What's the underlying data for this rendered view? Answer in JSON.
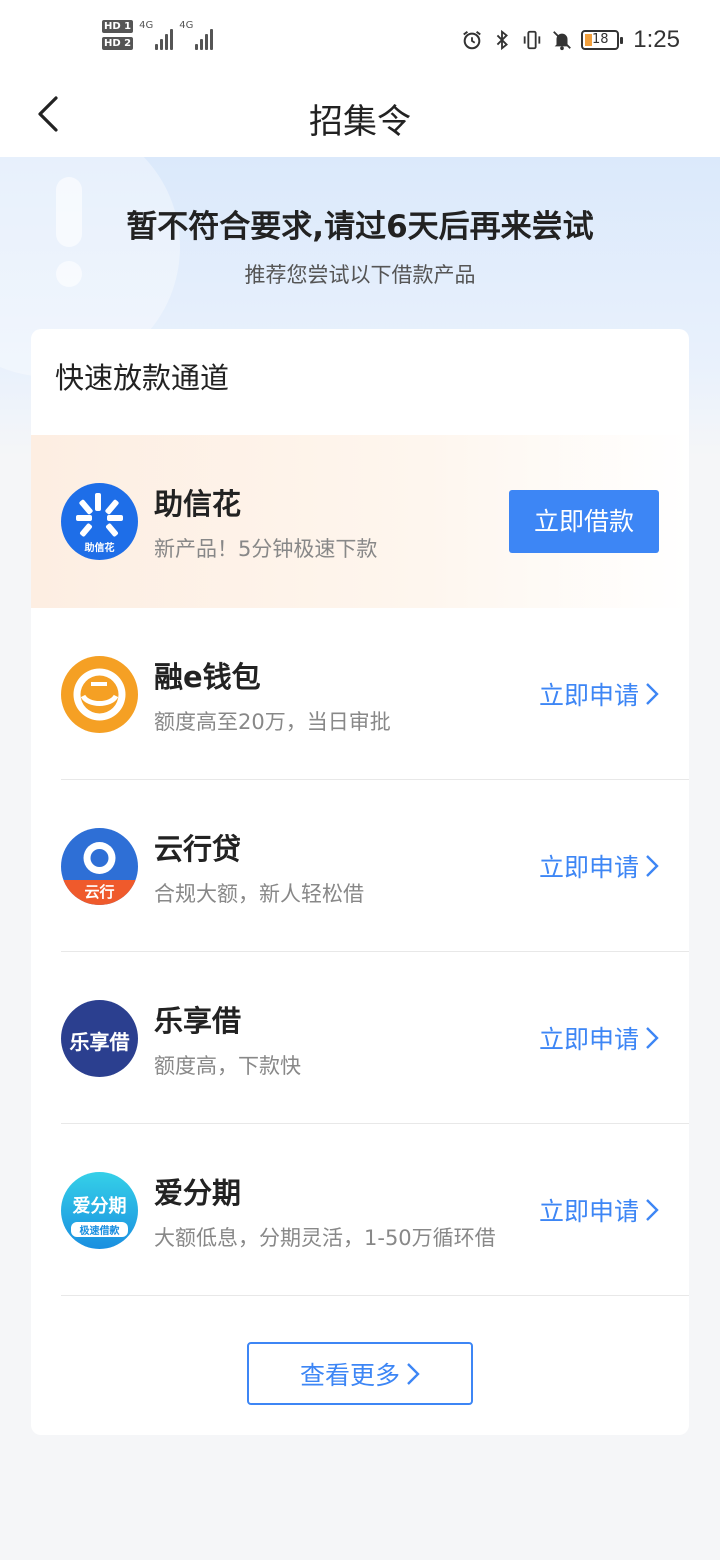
{
  "status_bar": {
    "sim1_label": "HD 1",
    "sim2_label": "HD 2",
    "network1": "4G",
    "network2": "4G",
    "battery_level": "18",
    "time": "1:25",
    "icons": [
      "alarm-icon",
      "bluetooth-icon",
      "vibrate-icon",
      "mute-icon",
      "battery-icon"
    ]
  },
  "nav": {
    "title": "招集令",
    "back_icon": "chevron-left-icon"
  },
  "hero": {
    "title": "暂不符合要求,请过6天后再来尝试",
    "subtitle": "推荐您尝试以下借款产品"
  },
  "section": {
    "title": "快速放款通道",
    "featured": {
      "name": "助信花",
      "desc": "新产品！5分钟极速下款",
      "logo_text": "助信花",
      "button": "立即借款"
    },
    "items": [
      {
        "name": "融e钱包",
        "desc": "额度高至20万，当日审批",
        "action": "立即申请",
        "logo_color": "#f5a024"
      },
      {
        "name": "云行贷",
        "desc": "合规大额，新人轻松借",
        "action": "立即申请",
        "logo_text": "云行",
        "logo_color": "#2e6fd6"
      },
      {
        "name": "乐享借",
        "desc": "额度高，下款快",
        "action": "立即申请",
        "logo_text": "乐享借",
        "logo_color": "#2b3f8f"
      },
      {
        "name": "爱分期",
        "desc": "大额低息，分期灵活，1-50万循环借",
        "action": "立即申请",
        "logo_text": "爱分期",
        "logo_sub": "极速借款",
        "logo_color": "#2bb7e0"
      }
    ],
    "more_button": "查看更多"
  },
  "colors": {
    "accent": "#3d86f5",
    "hero_bg": "#dbe9fb",
    "page_bg": "#f5f6f8"
  }
}
